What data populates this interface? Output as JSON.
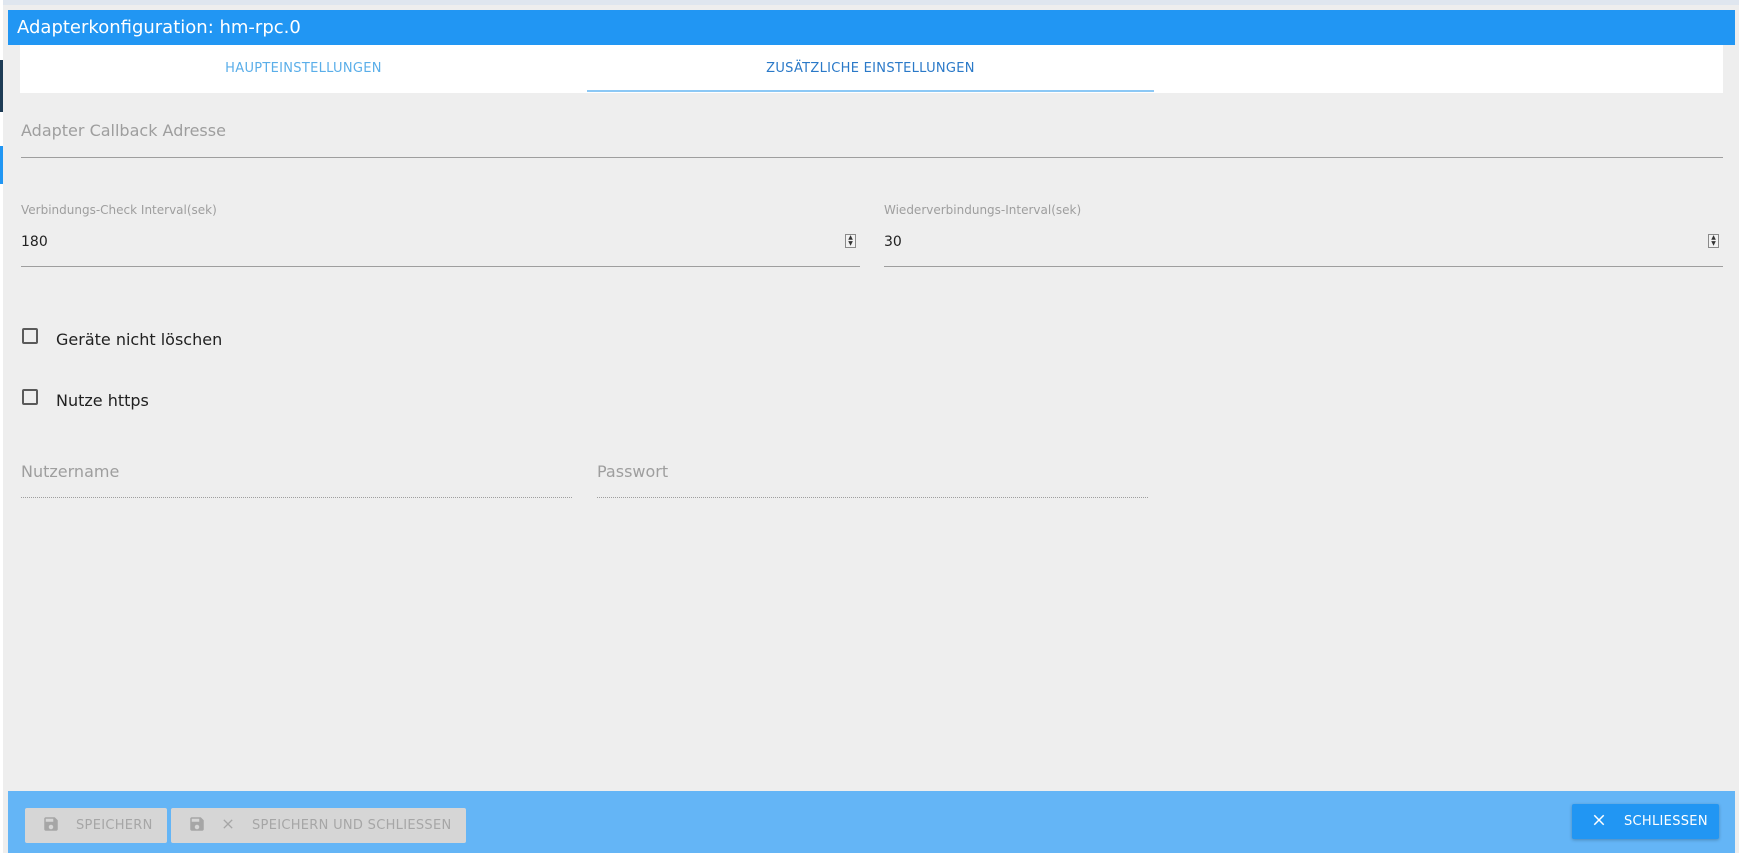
{
  "window": {
    "title": "Adapterkonfiguration: hm-rpc.0"
  },
  "tabs": [
    {
      "label": "HAUPTEINSTELLUNGEN",
      "active": false
    },
    {
      "label": "ZUSÄTZLICHE EINSTELLUNGEN",
      "active": true
    }
  ],
  "fields": {
    "callback_address": {
      "placeholder": "Adapter Callback Adresse",
      "value": ""
    },
    "check_interval": {
      "label": "Verbindungs-Check Interval(sek)",
      "value": "180"
    },
    "reconnect_interval": {
      "label": "Wiederverbindungs-Interval(sek)",
      "value": "30"
    },
    "username": {
      "placeholder": "Nutzername",
      "value": ""
    },
    "password": {
      "placeholder": "Passwort",
      "value": ""
    }
  },
  "checkboxes": [
    {
      "label": "Geräte nicht löschen",
      "checked": false
    },
    {
      "label": "Nutze https",
      "checked": false
    }
  ],
  "buttons": {
    "save": {
      "label": "SPEICHERN",
      "enabled": false,
      "icon": "floppy-icon"
    },
    "save_close": {
      "label": "SPEICHERN UND SCHLIESSEN",
      "enabled": false,
      "icons": [
        "floppy-icon",
        "close-icon"
      ]
    },
    "close": {
      "label": "SCHLIESSEN",
      "enabled": true,
      "icon": "close-icon"
    }
  },
  "colors": {
    "accent": "#2196f3",
    "bottom_bar": "#64b5f6",
    "background": "#eeeeee"
  }
}
